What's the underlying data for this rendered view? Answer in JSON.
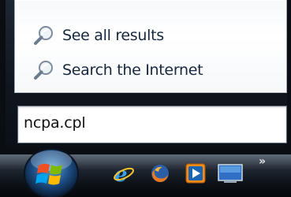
{
  "search_results": {
    "items": [
      {
        "label": "See all results",
        "icon": "magnifier-icon"
      },
      {
        "label": "Search the Internet",
        "icon": "magnifier-icon"
      }
    ]
  },
  "search_box": {
    "value": "ncpa.cpl"
  },
  "taskbar": {
    "start_button_icon": "windows-logo-icon",
    "quick_launch": [
      {
        "name": "internet-explorer-icon"
      },
      {
        "name": "firefox-icon"
      },
      {
        "name": "media-player-icon"
      },
      {
        "name": "show-desktop-icon"
      }
    ],
    "overflow_label": "»"
  },
  "colors": {
    "panel_bg": "#10161e",
    "results_bg": "#ffffff",
    "text": "#16283f",
    "taskbar_bg": "#0c1117"
  }
}
